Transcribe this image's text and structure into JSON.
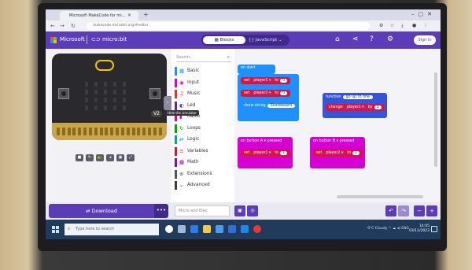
{
  "browser": {
    "tab_title": "Microsoft MakeCode for mi...",
    "url": "makecode.microbit.org/#editor",
    "new_tab_icon": "plus-icon",
    "close_icon": "close-icon"
  },
  "header": {
    "brand": "Microsoft",
    "product": "micro:bit",
    "blocks_label": "Blocks",
    "js_label": "JavaScript",
    "signin_label": "Sign In",
    "accent": "#5c3db8"
  },
  "toolbox": {
    "search_placeholder": "Search...",
    "categories": [
      {
        "label": "Basic",
        "color": "#1e90ff",
        "icon": "▦"
      },
      {
        "label": "Input",
        "color": "#d400d4",
        "icon": "◉"
      },
      {
        "label": "Music",
        "color": "#e63022",
        "icon": "♫"
      },
      {
        "label": "Led",
        "color": "#5c2d91",
        "icon": "◐"
      },
      {
        "label": "Radio",
        "color": "#e3008c",
        "icon": "▮"
      },
      {
        "label": "Loops",
        "color": "#00aa00",
        "icon": "↻"
      },
      {
        "label": "Logic",
        "color": "#00a4a6",
        "icon": "⇄"
      },
      {
        "label": "Variables",
        "color": "#dc143c",
        "icon": "≡"
      },
      {
        "label": "Math",
        "color": "#9400d3",
        "icon": "▦"
      },
      {
        "label": "Extensions",
        "color": "#555555",
        "icon": "⊕"
      },
      {
        "label": "Advanced",
        "color": "#3c3c3c",
        "icon": "⌄"
      }
    ],
    "tooltip": "Hide the simulator"
  },
  "workspace": {
    "on_start": "on start",
    "set1": "set",
    "player1": "player1 ▾",
    "to1": "to",
    "val1": "0",
    "set2": "set",
    "player2": "player2 ▾",
    "to2": "to",
    "val2": "0",
    "show_string": "show string",
    "scoreboard": "Scoreboard",
    "function_label": "function",
    "function_name": "go up to one",
    "change_label": "change",
    "change_var": "player1 ▾",
    "change_by": "by",
    "change_val": "1",
    "button_a": "on button  A ▾  pressed",
    "set_a": "set",
    "set_a_var": "player1 ▾",
    "set_a_to": "to",
    "set_a_val": "1",
    "button_b": "on button  B ▾  pressed",
    "set_b": "set",
    "set_b_var": "player2 ▾",
    "set_b_to": "to",
    "set_b_val": "1"
  },
  "bottom": {
    "download_label": "Download",
    "more_label": "•••",
    "project_placeholder": "Micro and Elec"
  },
  "taskbar": {
    "search_placeholder": "Type here to search",
    "tray_text": "9°C Cloudy  ^  ☁  ◂)  ENG",
    "time": "14:05",
    "date": "03/11/2023"
  },
  "simulator": {
    "version_badge": "V2"
  }
}
